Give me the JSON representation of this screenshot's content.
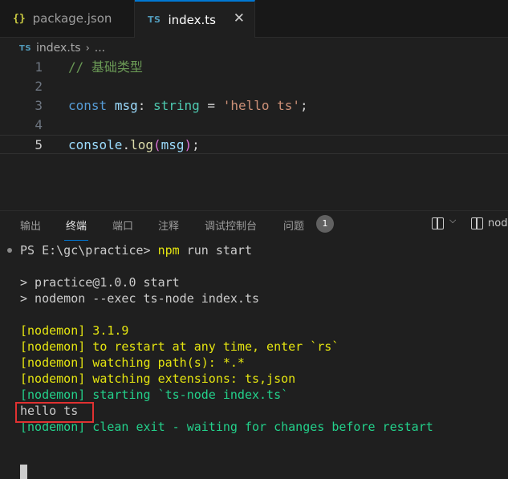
{
  "tabs": [
    {
      "icon": "{}",
      "label": "package.json"
    },
    {
      "icon": "TS",
      "label": "index.ts",
      "close": "✕"
    }
  ],
  "breadcrumb": {
    "icon": "TS",
    "file": "index.ts",
    "sep": "›",
    "more": "..."
  },
  "editor": {
    "lines": [
      {
        "n": "1",
        "comment": "// 基础类型"
      },
      {
        "n": "2"
      },
      {
        "n": "3",
        "kw": "const",
        "var": "msg",
        "colon": ": ",
        "type": "string",
        "eq": " = ",
        "str": "'hello ts'",
        "semi": ";"
      },
      {
        "n": "4"
      },
      {
        "n": "5",
        "obj": "console",
        "dot": ".",
        "fn": "log",
        "open": "(",
        "arg": "msg",
        "close": ")",
        "semi": ";"
      }
    ]
  },
  "panel": {
    "tabs": [
      "输出",
      "终端",
      "端口",
      "注释",
      "调试控制台",
      "问题"
    ],
    "active_tab": "终端",
    "problem_count": "1",
    "terminal_label": "node",
    "chevron": "⌵"
  },
  "terminal": {
    "prompt": "PS E:\\gc\\practice> ",
    "cmd_npm": "npm",
    "cmd_rest": " run start",
    "script_line1": "> practice@1.0.0 start",
    "script_line2": "> nodemon --exec ts-node index.ts",
    "nodemon_lines": [
      "[nodemon] 3.1.9",
      "[nodemon] to restart at any time, enter `rs`",
      "[nodemon] watching path(s): *.*",
      "[nodemon] watching extensions: ts,json"
    ],
    "starting": "[nodemon] starting `ts-node index.ts`",
    "output": "hello ts",
    "clean_exit": "[nodemon] clean exit - waiting for changes before restart"
  },
  "colors": {
    "accent": "#0078d4",
    "highlight": "#e03131",
    "nodemon_yellow": "#e5e510",
    "nodemon_green": "#23d18b"
  }
}
